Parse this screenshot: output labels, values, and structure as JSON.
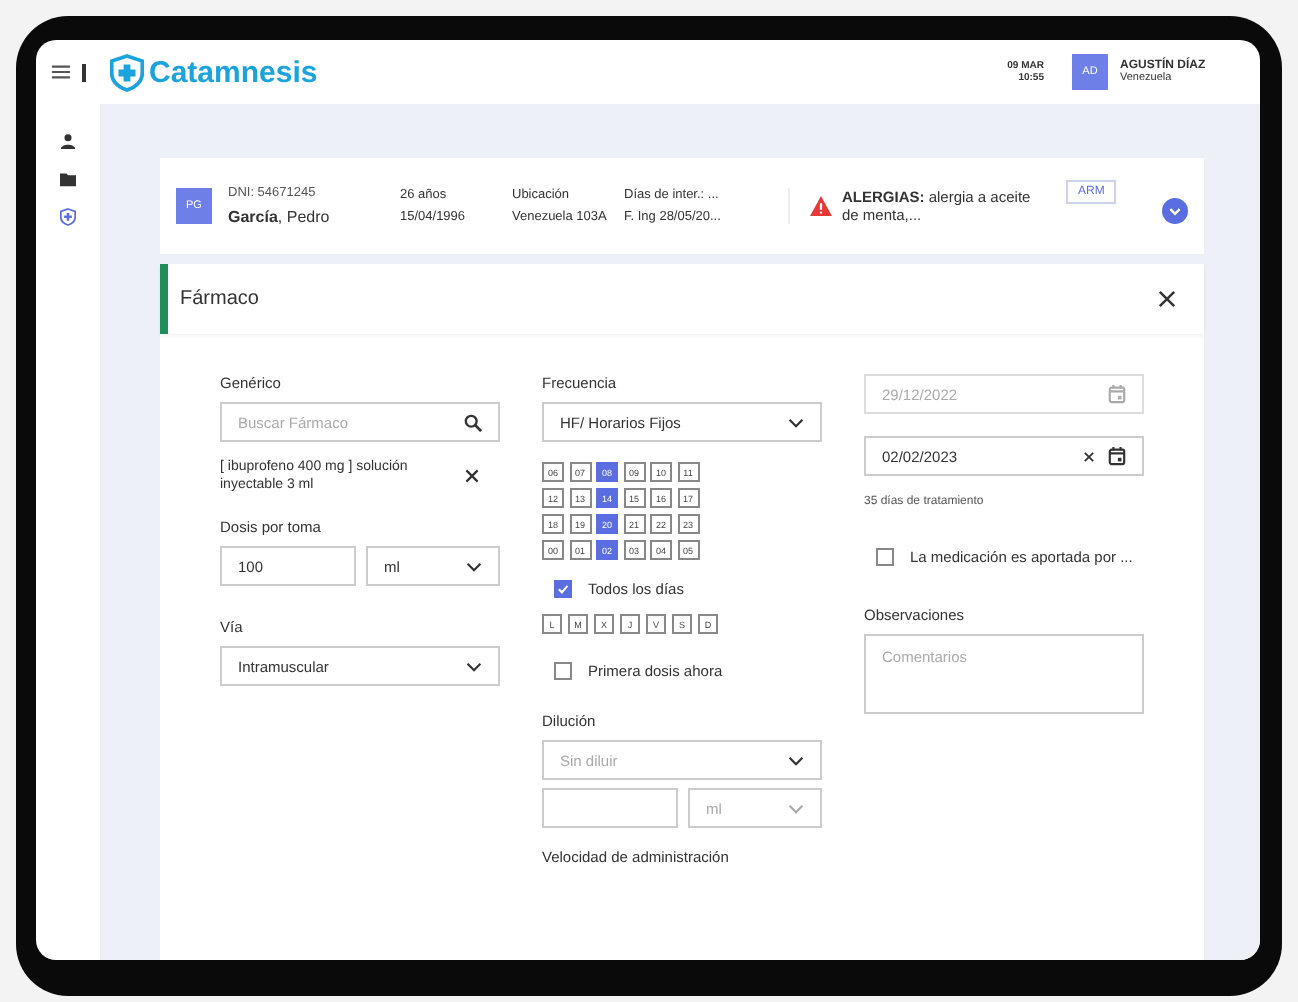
{
  "top_bar": {
    "brand": "Catamnesis",
    "date": "09 MAR",
    "time": "10:55",
    "user": {
      "initials": "AD",
      "name": "AGUSTÍN DÍAZ",
      "location": "Venezuela"
    }
  },
  "sidebar": {
    "items": [
      {
        "selected": false
      },
      {
        "selected": false
      },
      {
        "selected": true
      }
    ]
  },
  "patient": {
    "initials": "PG",
    "dni": "DNI: 54671245",
    "name": "**García**, Pedro",
    "age": "26 años",
    "birth_date": "15/04/1996",
    "location_label": "Ubicación",
    "location": "Venezuela 103A",
    "days_label": "Días de inter.: ...",
    "admission": "F. Ing 28/05/20...",
    "allergies": "**ALERGIAS:** alergia a aceite de menta,...",
    "tag": "ARM"
  },
  "modal": {
    "title": "Fármaco",
    "generic": {
      "label": "Genérico",
      "placeholder": "Buscar Fármaco",
      "selection": "[ ibuprofeno 400 mg ] solución inyectable 3 ml"
    },
    "dose": {
      "label": "Dosis por toma",
      "value": "100",
      "unit": "ml"
    },
    "route": {
      "label": "Vía",
      "value": "Intramuscular"
    },
    "frequency": {
      "label": "Frecuencia",
      "value": "HF/ Horarios Fijos",
      "hours": [
        {
          "label": "06",
          "selected": false
        },
        {
          "label": "07",
          "selected": false
        },
        {
          "label": "08",
          "selected": true
        },
        {
          "label": "09",
          "selected": false
        },
        {
          "label": "10",
          "selected": false
        },
        {
          "label": "11",
          "selected": false
        },
        {
          "label": "12",
          "selected": false
        },
        {
          "label": "13",
          "selected": false
        },
        {
          "label": "14",
          "selected": true
        },
        {
          "label": "15",
          "selected": false
        },
        {
          "label": "16",
          "selected": false
        },
        {
          "label": "17",
          "selected": false
        },
        {
          "label": "18",
          "selected": false
        },
        {
          "label": "19",
          "selected": false
        },
        {
          "label": "20",
          "selected": true
        },
        {
          "label": "21",
          "selected": false
        },
        {
          "label": "22",
          "selected": false
        },
        {
          "label": "23",
          "selected": false
        },
        {
          "label": "00",
          "selected": false
        },
        {
          "label": "01",
          "selected": false
        },
        {
          "label": "02",
          "selected": true
        },
        {
          "label": "03",
          "selected": false
        },
        {
          "label": "04",
          "selected": false
        },
        {
          "label": "05",
          "selected": false
        }
      ]
    },
    "all_days": {
      "label": "Todos los días",
      "checked": true
    },
    "weekdays": [
      {
        "label": "L",
        "selected": false
      },
      {
        "label": "M",
        "selected": false
      },
      {
        "label": "X",
        "selected": false
      },
      {
        "label": "J",
        "selected": false
      },
      {
        "label": "V",
        "selected": false
      },
      {
        "label": "S",
        "selected": false
      },
      {
        "label": "D",
        "selected": false
      }
    ],
    "first_dose": {
      "label": "Primera dosis ahora",
      "checked": false
    },
    "dilution": {
      "label": "Dilución",
      "placeholder": "Sin diluir",
      "unit": "ml",
      "unit_disabled": true
    },
    "speed": {
      "label": "Velocidad de administración"
    },
    "start_date": {
      "value": "29/12/2022",
      "disabled": true
    },
    "end_date": {
      "value": "02/02/2023",
      "disabled": false
    },
    "duration": "35 días de tratamiento",
    "supplied": {
      "label": "La medicación es aportada por ...",
      "checked": false
    },
    "notes": {
      "label": "Observaciones",
      "placeholder": "Comentarios"
    }
  }
}
